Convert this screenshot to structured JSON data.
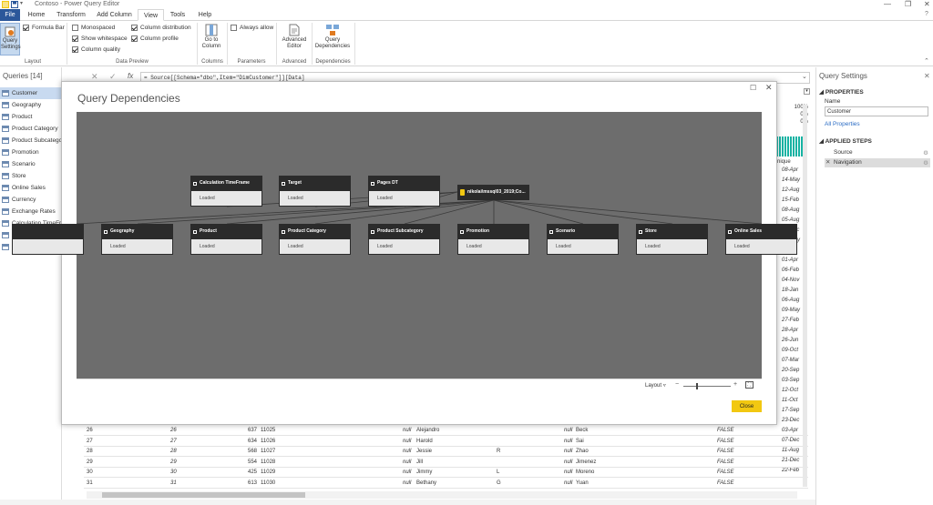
{
  "window": {
    "title": "Contoso - Power Query Editor"
  },
  "tabs": [
    "File",
    "Home",
    "Transform",
    "Add Column",
    "View",
    "Tools",
    "Help"
  ],
  "ribbon": {
    "query_settings": "Query Settings",
    "formula_bar": "Formula Bar",
    "layout_label": "Layout",
    "monospaced": "Monospaced",
    "show_whitespace": "Show whitespace",
    "column_quality": "Column quality",
    "column_distribution": "Column distribution",
    "column_profile": "Column profile",
    "data_preview_label": "Data Preview",
    "go_to_column": "Go to Column",
    "columns_label": "Columns",
    "always_allow": "Always allow",
    "parameters_label": "Parameters",
    "advanced_editor": "Advanced Editor",
    "advanced_label": "Advanced",
    "query_dependencies": "Query Dependencies",
    "dependencies_label": "Dependencies"
  },
  "queries": {
    "header": "Queries [14]",
    "items": [
      "Customer",
      "Geography",
      "Product",
      "Product Category",
      "Product Subcatego",
      "Promotion",
      "Scenario",
      "Store",
      "Online Sales",
      "Currency",
      "Exchange Rates",
      "Calculation TimeFr",
      "Target",
      "Pages DT"
    ]
  },
  "formula": {
    "text": "= Source[[Schema=\"dbo\",Item=\"DimCustomer\"]][Data]"
  },
  "settings": {
    "title": "Query Settings",
    "properties": "PROPERTIES",
    "name_label": "Name",
    "name_value": "Customer",
    "all_properties": "All Properties",
    "applied_steps": "APPLIED STEPS",
    "steps": [
      "Source",
      "Navigation"
    ]
  },
  "profile": {
    "valid": "100%",
    "error": "0%",
    "empty": "0%",
    "unique": "nique"
  },
  "dates": [
    "08-Apr",
    "14-May",
    "12-Aug",
    "15-Feb",
    "08-Aug",
    "05-Aug",
    "06-Dec",
    "09-May",
    "07-Jul",
    "01-Apr",
    "06-Feb",
    "04-Nov",
    "18-Jan",
    "06-Aug",
    "09-May",
    "27-Feb",
    "28-Apr",
    "26-Jun",
    "09-Oct",
    "07-Mar",
    "20-Sep",
    "03-Sep",
    "12-Oct",
    "11-Oct",
    "17-Sep",
    "23-Dec",
    "03-Apr",
    "07-Dec",
    "11-Aug",
    "21-Dec",
    "22-Feb"
  ],
  "dialog": {
    "title": "Query Dependencies",
    "layout_label": "Layout",
    "close_label": "Close",
    "source_node": "nikolai\\mssql03_2019;Co...",
    "top_nodes": [
      {
        "title": "Calculation TimeFrame",
        "status": "Loaded"
      },
      {
        "title": "Target",
        "status": "Loaded"
      },
      {
        "title": "Pages DT",
        "status": "Loaded"
      }
    ],
    "row_nodes": [
      {
        "title": "Geography",
        "status": "Loaded"
      },
      {
        "title": "Product",
        "status": "Loaded"
      },
      {
        "title": "Product Category",
        "status": "Loaded"
      },
      {
        "title": "Product Subcategory",
        "status": "Loaded"
      },
      {
        "title": "Promotion",
        "status": "Loaded"
      },
      {
        "title": "Scenario",
        "status": "Loaded"
      },
      {
        "title": "Store",
        "status": "Loaded"
      },
      {
        "title": "Online Sales",
        "status": "Loaded"
      }
    ]
  },
  "rows": [
    {
      "n": "26",
      "idx": "26",
      "key": "637",
      "id": "11025",
      "first": "Alejandro",
      "mid": "",
      "last": "Beck",
      "flag": "FALSE",
      "date": "23-Dec"
    },
    {
      "n": "27",
      "idx": "27",
      "key": "634",
      "id": "11026",
      "first": "Harold",
      "mid": "",
      "last": "Sai",
      "flag": "FALSE",
      "date": "03-Apr"
    },
    {
      "n": "28",
      "idx": "28",
      "key": "568",
      "id": "11027",
      "first": "Jessie",
      "mid": "R",
      "last": "Zhao",
      "flag": "FALSE",
      "date": "07-Dec"
    },
    {
      "n": "29",
      "idx": "29",
      "key": "554",
      "id": "11028",
      "first": "Jill",
      "mid": "",
      "last": "Jimenez",
      "flag": "FALSE",
      "date": "11-Aug"
    },
    {
      "n": "30",
      "idx": "30",
      "key": "425",
      "id": "11029",
      "first": "Jimmy",
      "mid": "L",
      "last": "Moreno",
      "flag": "FALSE",
      "date": "21-Dec"
    },
    {
      "n": "31",
      "idx": "31",
      "key": "613",
      "id": "11030",
      "first": "Bethany",
      "mid": "G",
      "last": "Yuan",
      "flag": "FALSE",
      "date": "22-Feb"
    }
  ],
  "null_text": "null"
}
